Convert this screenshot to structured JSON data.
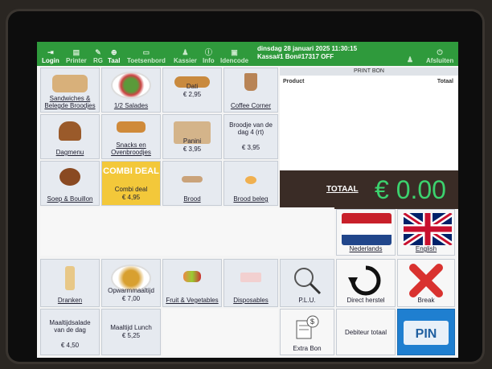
{
  "topbar": {
    "login": "Login",
    "printer": "Printer",
    "rg": "RG",
    "taal": "Taal",
    "toetsenbord": "Toetsenbord",
    "kassier": "Kassier",
    "info": "Info",
    "idencode": "Idencode",
    "afsluiten": "Afsluiten",
    "datetime": "dinsdag 28 januari 2025 11:30:15",
    "session": "Kassa#1 Bon#17317 OFF"
  },
  "products": [
    {
      "label": "Sandwiches & Belegde Broodjes",
      "price": ""
    },
    {
      "label": "1/2 Salades",
      "price": ""
    },
    {
      "label": "Dati",
      "price": "€ 2,95"
    },
    {
      "label": "Coffee Corner",
      "price": ""
    },
    {
      "label": "Dagmenu",
      "price": ""
    },
    {
      "label": "Snacks en Ovenbroodjes",
      "price": ""
    },
    {
      "label": "Panini",
      "price": "€ 3,95"
    },
    {
      "label": "Broodje van de dag 4 (rt)",
      "price": "€ 3,95"
    },
    {
      "label": "Soep & Bouillon",
      "price": ""
    },
    {
      "label": "Combi deal",
      "price": "€ 4,95"
    },
    {
      "label": "Brood",
      "price": ""
    },
    {
      "label": "Brood beleg",
      "price": ""
    },
    {
      "label": "Dranken",
      "price": ""
    },
    {
      "label": "Opwarmmaaltijd",
      "price": "€ 7,00"
    },
    {
      "label": "Fruit & Vegetables",
      "price": ""
    },
    {
      "label": "Disposables",
      "price": ""
    },
    {
      "label": "Maaltijdsalade van de dag",
      "price": "€ 4,50"
    },
    {
      "label": "Maaltijd Lunch",
      "price": "€ 5,25"
    }
  ],
  "combi_banner": "COMBI DEAL",
  "receipt": {
    "header": "PRINT BON",
    "col_product": "Product",
    "col_total": "Totaal"
  },
  "total": {
    "label": "TOTAAL",
    "value": "€ 0.00"
  },
  "functions": {
    "nederlands": "Nederlands",
    "english": "English",
    "plu": "P.L.U.",
    "direct_herstel": "Direct herstel",
    "break": "Break",
    "extra_bon": "Extra Bon",
    "debiteur": "Debiteur totaal",
    "pin": "PIN"
  },
  "colors": {
    "topbar": "#2f9a3c",
    "total_bg": "#3a2c26",
    "total_value": "#3cd26e",
    "combi": "#f3c83a",
    "pin": "#1f7fd0"
  }
}
